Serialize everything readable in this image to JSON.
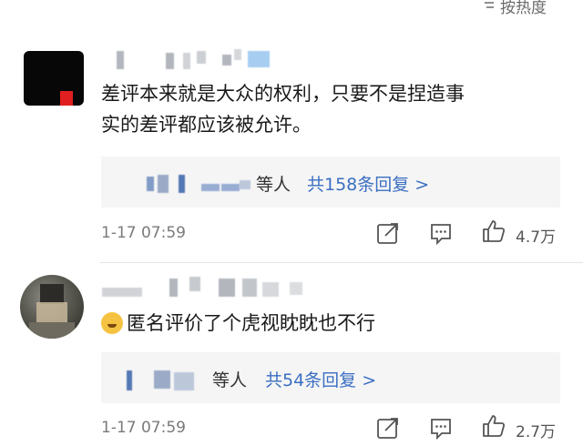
{
  "sort": {
    "label": "按热度"
  },
  "comments": [
    {
      "text_line1": "差评本来就是大众的权利，只要不是捏造事",
      "text_line2": "实的差评都应该被允许。",
      "replies": {
        "suffix": "等人",
        "count_text": "共158条回复 >"
      },
      "time": "1-17 07:59",
      "likes": "4.7万"
    },
    {
      "text": "匿名评价了个虎视眈眈也不行",
      "replies": {
        "suffix": "等人",
        "count_text": "共54条回复 >"
      },
      "time": "1-17 07:59",
      "likes": "2.7万"
    }
  ]
}
